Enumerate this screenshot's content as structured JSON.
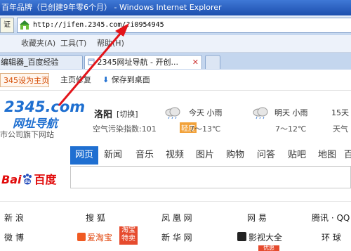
{
  "window": {
    "title": "百年品牌（已创建9年零6个月） - Windows Internet Explorer"
  },
  "address": {
    "left_fragment": "证",
    "url": "http://jifen.2345.com/?i0954945"
  },
  "menu": {
    "items": [
      "收藏夹(A)",
      "工具(T)",
      "帮助(H)"
    ]
  },
  "tabs": [
    {
      "label": "编辑器_百度经验"
    },
    {
      "label": "2345网址导航 - 开创..."
    }
  ],
  "page_toolbar": {
    "set_home": "345设为主页",
    "repair": "主页修复",
    "save_desktop": "保存到桌面"
  },
  "logo": {
    "main": "2345.com",
    "sub": "网址导航",
    "tagline": "市公司旗下网站"
  },
  "weather": {
    "city": "洛阳",
    "switch": "[切换]",
    "aqi_label": "空气污染指数:101",
    "aqi_level": "轻度",
    "aqi_color": "#f2a23a",
    "days": [
      {
        "title": "今天 小雨",
        "temp": "7～13℃",
        "icon": "rain-cloud-icon"
      },
      {
        "title": "明天 小雨",
        "temp": "7～12℃",
        "icon": "rain-cloud-icon"
      },
      {
        "title": "15天",
        "temp": "天气",
        "icon": "none"
      }
    ]
  },
  "search": {
    "tabs": [
      "网页",
      "新闻",
      "音乐",
      "视频",
      "图片",
      "购物",
      "问答",
      "贴吧",
      "地图",
      "百"
    ],
    "active_tab": "网页",
    "active_color": "#1f6fd1",
    "engine": "百度"
  },
  "links": {
    "row1": [
      "新 浪",
      "搜 狐",
      "凤 凰 网",
      "网 易",
      "腾讯 · QQ"
    ],
    "row2": [
      "微 博",
      "爱淘宝",
      "新 华 网",
      "影视大全",
      "环 球"
    ],
    "taobao_tag": [
      "淘宝",
      "特卖"
    ],
    "bottom_tag": "优惠"
  }
}
